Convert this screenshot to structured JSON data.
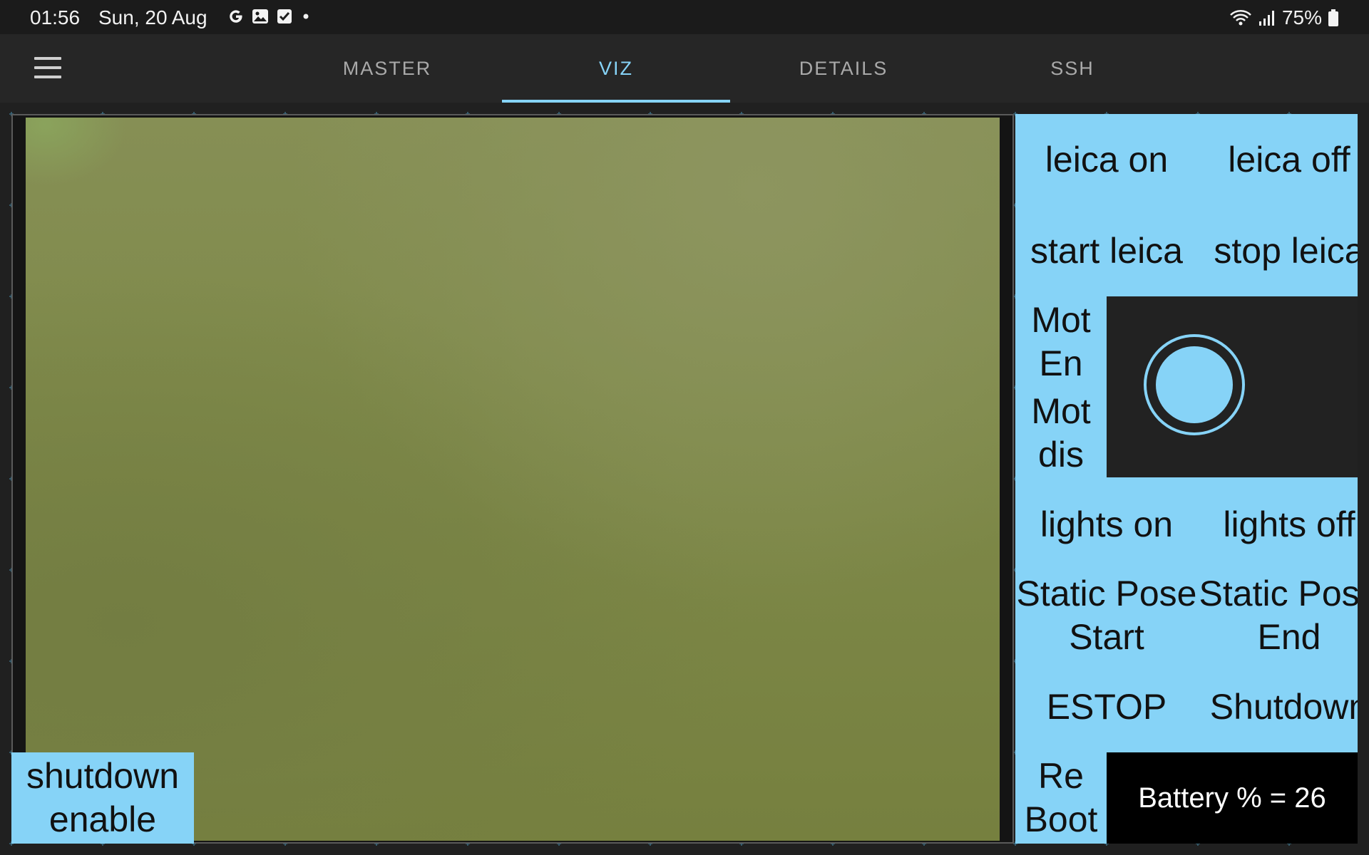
{
  "status_bar": {
    "time": "01:56",
    "date": "Sun, 20 Aug",
    "battery": "75%",
    "icons": [
      "google-icon",
      "gallery-icon",
      "task-check-icon",
      "notification-dot-icon",
      "wifi-icon",
      "signal-icon",
      "battery-icon"
    ]
  },
  "tabs": [
    {
      "label": "MASTER"
    },
    {
      "label": "VIZ",
      "active": true
    },
    {
      "label": "DETAILS"
    },
    {
      "label": "SSH"
    }
  ],
  "controls": {
    "leica_on": "leica on",
    "leica_off": "leica off",
    "start_leica": "start leica",
    "stop_leica": "stop leica",
    "mot_en": "Mot En",
    "mot_dis": "Mot dis",
    "lights_on": "lights on",
    "lights_off": "lights off",
    "static_pose_start": "Static Pose Start",
    "static_pose_end": "Static Pose End",
    "estop": "ESTOP",
    "shutdown": "Shutdown",
    "reboot": "Re Boot",
    "battery_readout": "Battery % = 26"
  },
  "video": {
    "shutdown_enable": "shutdown enable"
  },
  "colors": {
    "accent": "#86d3f7",
    "background": "#202020",
    "appbar": "#262626"
  }
}
